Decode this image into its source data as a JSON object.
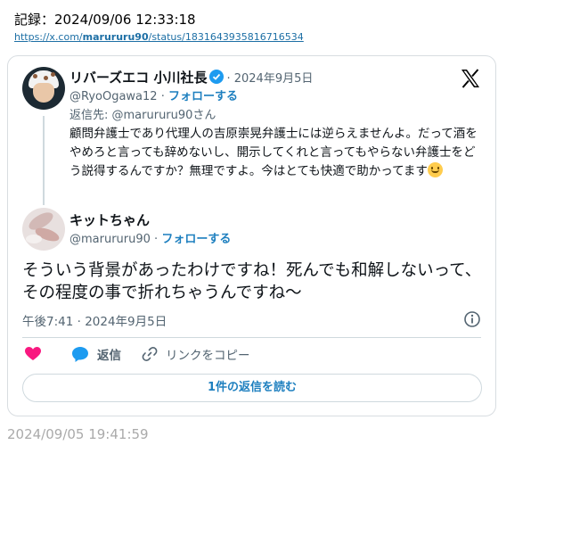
{
  "record": {
    "label": "記録：2024/09/06 12:33:18",
    "link_prefix": "https://x.com/",
    "link_user": "marururu90",
    "link_suffix": "/status/1831643935816716534"
  },
  "quoted": {
    "name": "リバーズエコ 小川社長",
    "date": "· 2024年9月5日",
    "handle": "@RyoOgawa12 ·",
    "follow": "フォローする",
    "reply_to": "返信先: @marururu90さん",
    "text": "顧問弁護士であり代理人の吉原崇晃弁護士には逆らえませんよ。だって酒をやめろと言っても辞めないし、開示してくれと言ってもやらない弁護士をどう説得するんですか？無理ですよ。今はとても快適で助かってます"
  },
  "main": {
    "name": "キットちゃん",
    "handle": "@marururu90 ·",
    "follow": "フォローする",
    "text": "そういう背景があったわけですね！死んでも和解しないって、その程度の事で折れちゃうんですね〜",
    "time": "午後7:41 · 2024年9月5日"
  },
  "actions": {
    "reply": "返信",
    "copy_link": "リンクをコピー"
  },
  "read_replies": "1件の返信を読む",
  "footer_time": "2024/09/05 19:41:59",
  "colors": {
    "accent": "#1d7fbf",
    "like": "#f91880",
    "reply_blue": "#1d9bf0",
    "verified": "#1d9bf0"
  }
}
